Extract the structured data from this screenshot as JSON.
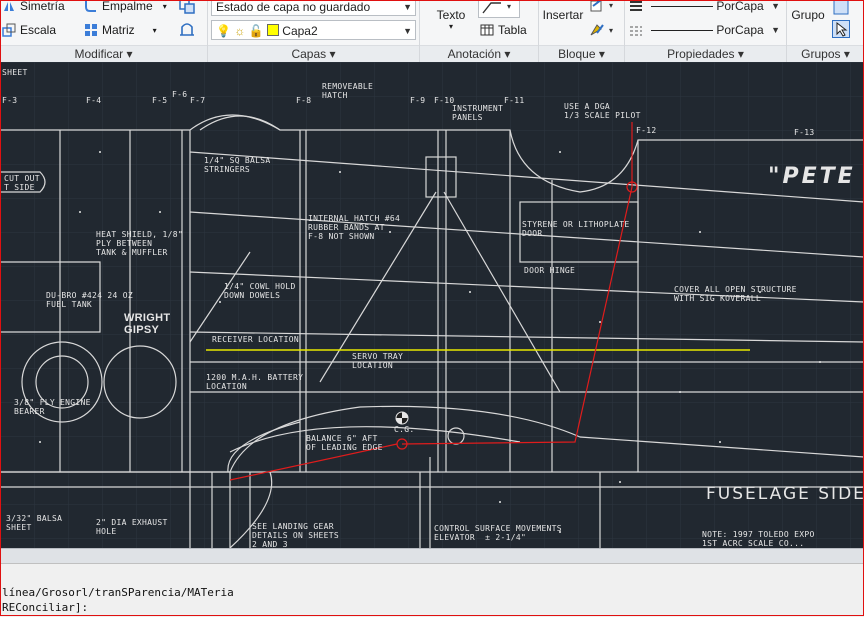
{
  "ribbon": {
    "modificar": {
      "title": "Modificar",
      "simetria": "Simetría",
      "empalme": "Empalme",
      "escala": "Escala",
      "matriz": "Matriz"
    },
    "capas": {
      "title": "Capas",
      "state_dropdown": "Estado de capa no guardado",
      "layer_dropdown": "Capa2",
      "layer_color": "#ffff00"
    },
    "anotacion": {
      "title": "Anotación",
      "texto": "Texto",
      "tabla": "Tabla"
    },
    "bloque": {
      "title": "Bloque",
      "insertar": "Insertar"
    },
    "propiedades": {
      "title": "Propiedades",
      "porcapa_1": "PorCapa",
      "porcapa_2": "PorCapa"
    },
    "grupos": {
      "title": "Grupos",
      "grupo": "Grupo"
    }
  },
  "drawing": {
    "labels": {
      "sheet": "SHEET",
      "f3": "F-3",
      "f4": "F-4",
      "f5": "F-5",
      "f6": "F-6",
      "f7": "F-7",
      "f8": "F-8",
      "f9": "F-9",
      "f10": "F-10",
      "f11": "F-11",
      "f12": "F-12",
      "f13": "F-13",
      "removeable_hatch": "REMOVEABLE\nHATCH",
      "instrument_panels": "INSTRUMENT\nPANELS",
      "use_dga": "USE A DGA\n1/3 SCALE PILOT",
      "sq_balsa": "1/4\" SQ BALSA\nSTRINGERS",
      "cut_out": "CUT OUT\nT SIDE",
      "heat_shield": "HEAT SHIELD, 1/8\"\nPLY BETWEEN\nTANK & MUFFLER",
      "internal_hatch": "INTERNAL HATCH #64\nRUBBER BANDS AT\nF-8 NOT SHOWN",
      "styrene": "STYRENE OR LITHOPLATE\nDOOR",
      "door_hinge": "DOOR HINGE",
      "du_bro": "DU-BRO #424 24 OZ\nFUEL TANK",
      "cowl_hold": "1/4\" COWL HOLD\nDOWN DOWELS",
      "cover_structure": "COVER ALL OPEN STRUCTURE\nWITH SIG KOVERALL",
      "wright_gipsy": "WRIGHT\nGIPSY",
      "receiver_location": "RECEIVER LOCATION",
      "servo_tray": "SERVO TRAY\nLOCATION",
      "battery": "1200 M.A.H. BATTERY\nLOCATION",
      "fly_engine": "3/8\" FLY ENGINE\nBEARER",
      "cg": "C.G.",
      "balance": "BALANCE 6\" AFT\nOF LEADING EDGE",
      "balsa_sheet": "3/32\" BALSA\nSHEET",
      "exhaust_hole": "2\" DIA EXHAUST\nHOLE",
      "landing_gear": "SEE LANDING GEAR\nDETAILS ON SHEETS\n2 AND 3",
      "control_surface": "CONTROL SURFACE MOVEMENTS\nELEVATOR  ± 2-1/4\"",
      "fuselage_side": "FUSELAGE SIDE",
      "pete": "\"PETE",
      "note": "NOTE: 1997 TOLEDO EXPO\n1ST ACRC SCALE CO..."
    }
  },
  "command": {
    "line1": "línea/Grosorl/tranSParencia/MATeria",
    "line2": "REConciliar]:"
  }
}
